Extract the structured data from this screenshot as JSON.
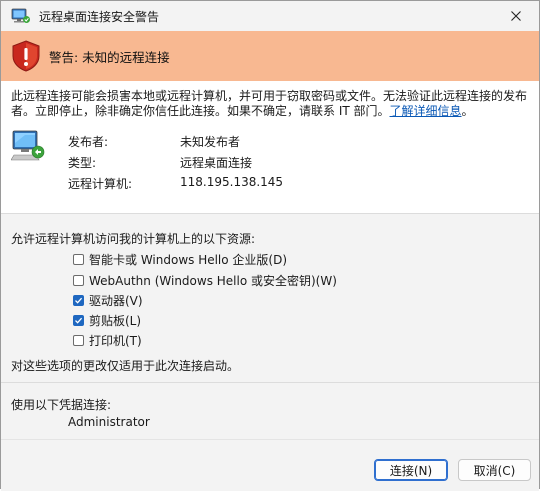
{
  "window": {
    "title": "远程桌面连接安全警告"
  },
  "banner": {
    "text": "警告: 未知的远程连接"
  },
  "warning": {
    "text": "此远程连接可能会损害本地或远程计算机，并可用于窃取密码或文件。无法验证此远程连接的发布者。立即停止，除非确定你信任此连接。如果不确定，请联系 IT 部门。",
    "link": "了解详细信息",
    "suffix": "。"
  },
  "details": [
    {
      "label": "发布者:",
      "value": "未知发布者"
    },
    {
      "label": "类型:",
      "value": "远程桌面连接"
    },
    {
      "label": "远程计算机:",
      "value": "118.195.138.145"
    }
  ],
  "permissions": {
    "title": "允许远程计算机访问我的计算机上的以下资源:",
    "items": [
      {
        "label": "智能卡或 Windows Hello 企业版(D)",
        "checked": false
      },
      {
        "label": "WebAuthn (Windows Hello 或安全密钥)(W)",
        "checked": false
      },
      {
        "label": "驱动器(V)",
        "checked": true
      },
      {
        "label": "剪贴板(L)",
        "checked": true
      },
      {
        "label": "打印机(T)",
        "checked": false
      }
    ],
    "note": "对这些选项的更改仅适用于此次连接启动。"
  },
  "credentials": {
    "title": "使用以下凭据连接:",
    "user": "Administrator"
  },
  "buttons": {
    "connect": "连接(N)",
    "cancel": "取消(C)"
  },
  "colors": {
    "banner": "#f8b891",
    "accent": "#1e67c0",
    "link": "#0a58b5"
  },
  "icons": {
    "title": "remote-desktop-icon",
    "banner": "warning-shield-icon",
    "computer": "computer-icon",
    "close": "close-icon"
  }
}
